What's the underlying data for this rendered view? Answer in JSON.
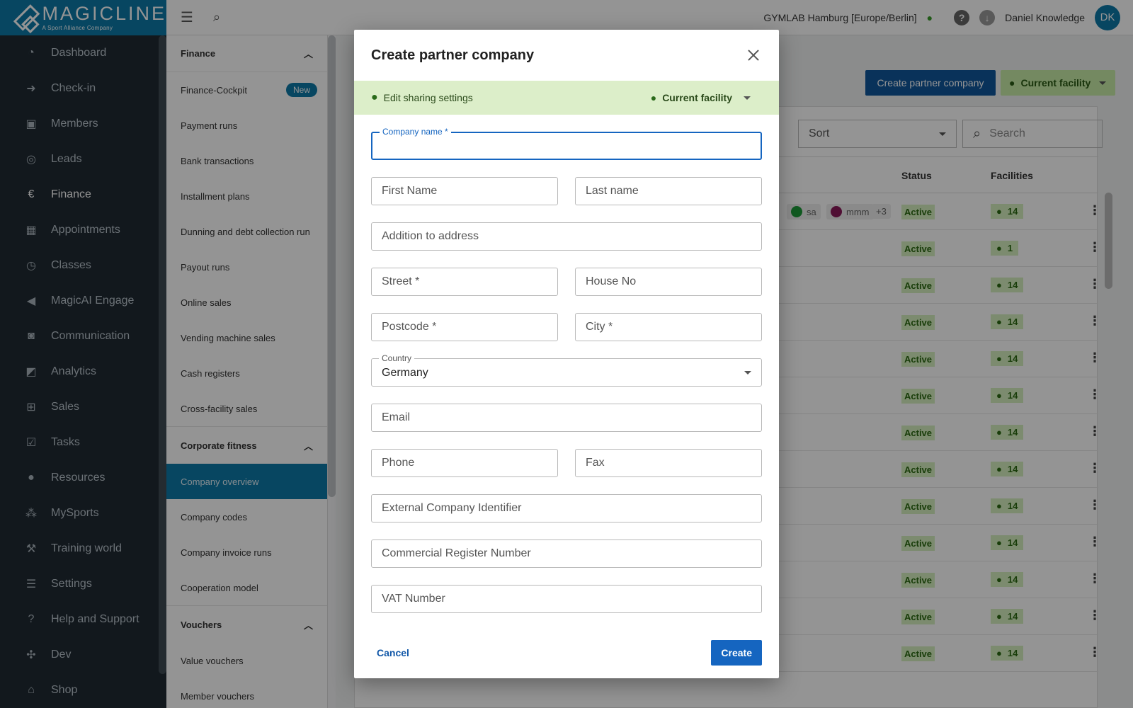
{
  "brand": {
    "name": "MAGICLINE",
    "tagline": "A Sport Alliance Company"
  },
  "topbar": {
    "facility": "GYMLAB Hamburg [Europe/Berlin]",
    "user_name": "Daniel Knowledge",
    "avatar_initials": "DK"
  },
  "nav": {
    "items": [
      {
        "label": "Dashboard",
        "icon": "dashboard-icon"
      },
      {
        "label": "Check-in",
        "icon": "check-in-icon"
      },
      {
        "label": "Members",
        "icon": "members-icon"
      },
      {
        "label": "Leads",
        "icon": "leads-icon"
      },
      {
        "label": "Finance",
        "icon": "finance-icon",
        "active": true
      },
      {
        "label": "Appointments",
        "icon": "calendar-icon"
      },
      {
        "label": "Classes",
        "icon": "classes-icon"
      },
      {
        "label": "MagicAI Engage",
        "icon": "megaphone-icon"
      },
      {
        "label": "Communication",
        "icon": "chat-icon"
      },
      {
        "label": "Analytics",
        "icon": "analytics-icon"
      },
      {
        "label": "Sales",
        "icon": "cart-icon"
      },
      {
        "label": "Tasks",
        "icon": "tasks-icon"
      },
      {
        "label": "Resources",
        "icon": "resources-icon"
      },
      {
        "label": "MySports",
        "icon": "mysports-icon"
      },
      {
        "label": "Training world",
        "icon": "dumbbell-icon"
      },
      {
        "label": "Settings",
        "icon": "settings-icon"
      },
      {
        "label": "Help and Support",
        "icon": "help-icon"
      },
      {
        "label": "Dev",
        "icon": "dev-icon"
      },
      {
        "label": "Shop",
        "icon": "shop-icon"
      }
    ]
  },
  "subnav": {
    "finance_header": "Finance",
    "finance_items": [
      {
        "label": "Finance-Cockpit",
        "badge": "New"
      },
      {
        "label": "Payment runs"
      },
      {
        "label": "Bank transactions"
      },
      {
        "label": "Installment plans"
      },
      {
        "label": "Dunning and debt collection run"
      },
      {
        "label": "Payout runs"
      },
      {
        "label": "Online sales"
      },
      {
        "label": "Vending machine sales"
      },
      {
        "label": "Cash registers"
      },
      {
        "label": "Cross-facility sales"
      }
    ],
    "corporate_header": "Corporate fitness",
    "corporate_items": [
      {
        "label": "Company overview",
        "active": true
      },
      {
        "label": "Company codes"
      },
      {
        "label": "Company invoice runs"
      },
      {
        "label": "Cooperation model"
      }
    ],
    "vouchers_header": "Vouchers",
    "voucher_items": [
      {
        "label": "Value vouchers"
      },
      {
        "label": "Member vouchers"
      }
    ]
  },
  "main": {
    "create_button": "Create partner company",
    "facility_button": "Current facility",
    "sort_placeholder": "Sort",
    "search_placeholder": "Search",
    "columns": {
      "status": "Status",
      "facilities": "Facilities"
    },
    "first_row_tags": {
      "tag1": "sa",
      "tag2": "mmm",
      "more": "+3"
    },
    "rows": [
      {
        "status": "Active",
        "facilities": "14"
      },
      {
        "status": "Active",
        "facilities": "1"
      },
      {
        "status": "Active",
        "facilities": "14"
      },
      {
        "status": "Active",
        "facilities": "14"
      },
      {
        "status": "Active",
        "facilities": "14"
      },
      {
        "status": "Active",
        "facilities": "14"
      },
      {
        "status": "Active",
        "facilities": "14"
      },
      {
        "status": "Active",
        "facilities": "14"
      },
      {
        "status": "Active",
        "facilities": "14"
      },
      {
        "status": "Active",
        "facilities": "14"
      },
      {
        "status": "Active",
        "facilities": "14"
      },
      {
        "status": "Active",
        "facilities": "14"
      },
      {
        "status": "Active",
        "facilities": "14"
      }
    ]
  },
  "modal": {
    "title": "Create partner company",
    "sharing_link": "Edit sharing settings",
    "facility_select": "Current facility",
    "fields": {
      "company_name_label": "Company name *",
      "first_name": "First Name",
      "last_name": "Last name",
      "address_addition": "Addition to address",
      "street": "Street *",
      "house_no": "House No",
      "postcode": "Postcode *",
      "city": "City *",
      "country_label": "Country",
      "country_value": "Germany",
      "email": "Email",
      "phone": "Phone",
      "fax": "Fax",
      "external_id": "External Company Identifier",
      "commercial_register": "Commercial Register Number",
      "vat": "VAT Number"
    },
    "cancel_label": "Cancel",
    "create_label": "Create"
  },
  "colors": {
    "brand": "#0d79a8",
    "nav_bg": "#1f2a33",
    "primary": "#1565c0",
    "success_bg": "#d6f0c0"
  }
}
